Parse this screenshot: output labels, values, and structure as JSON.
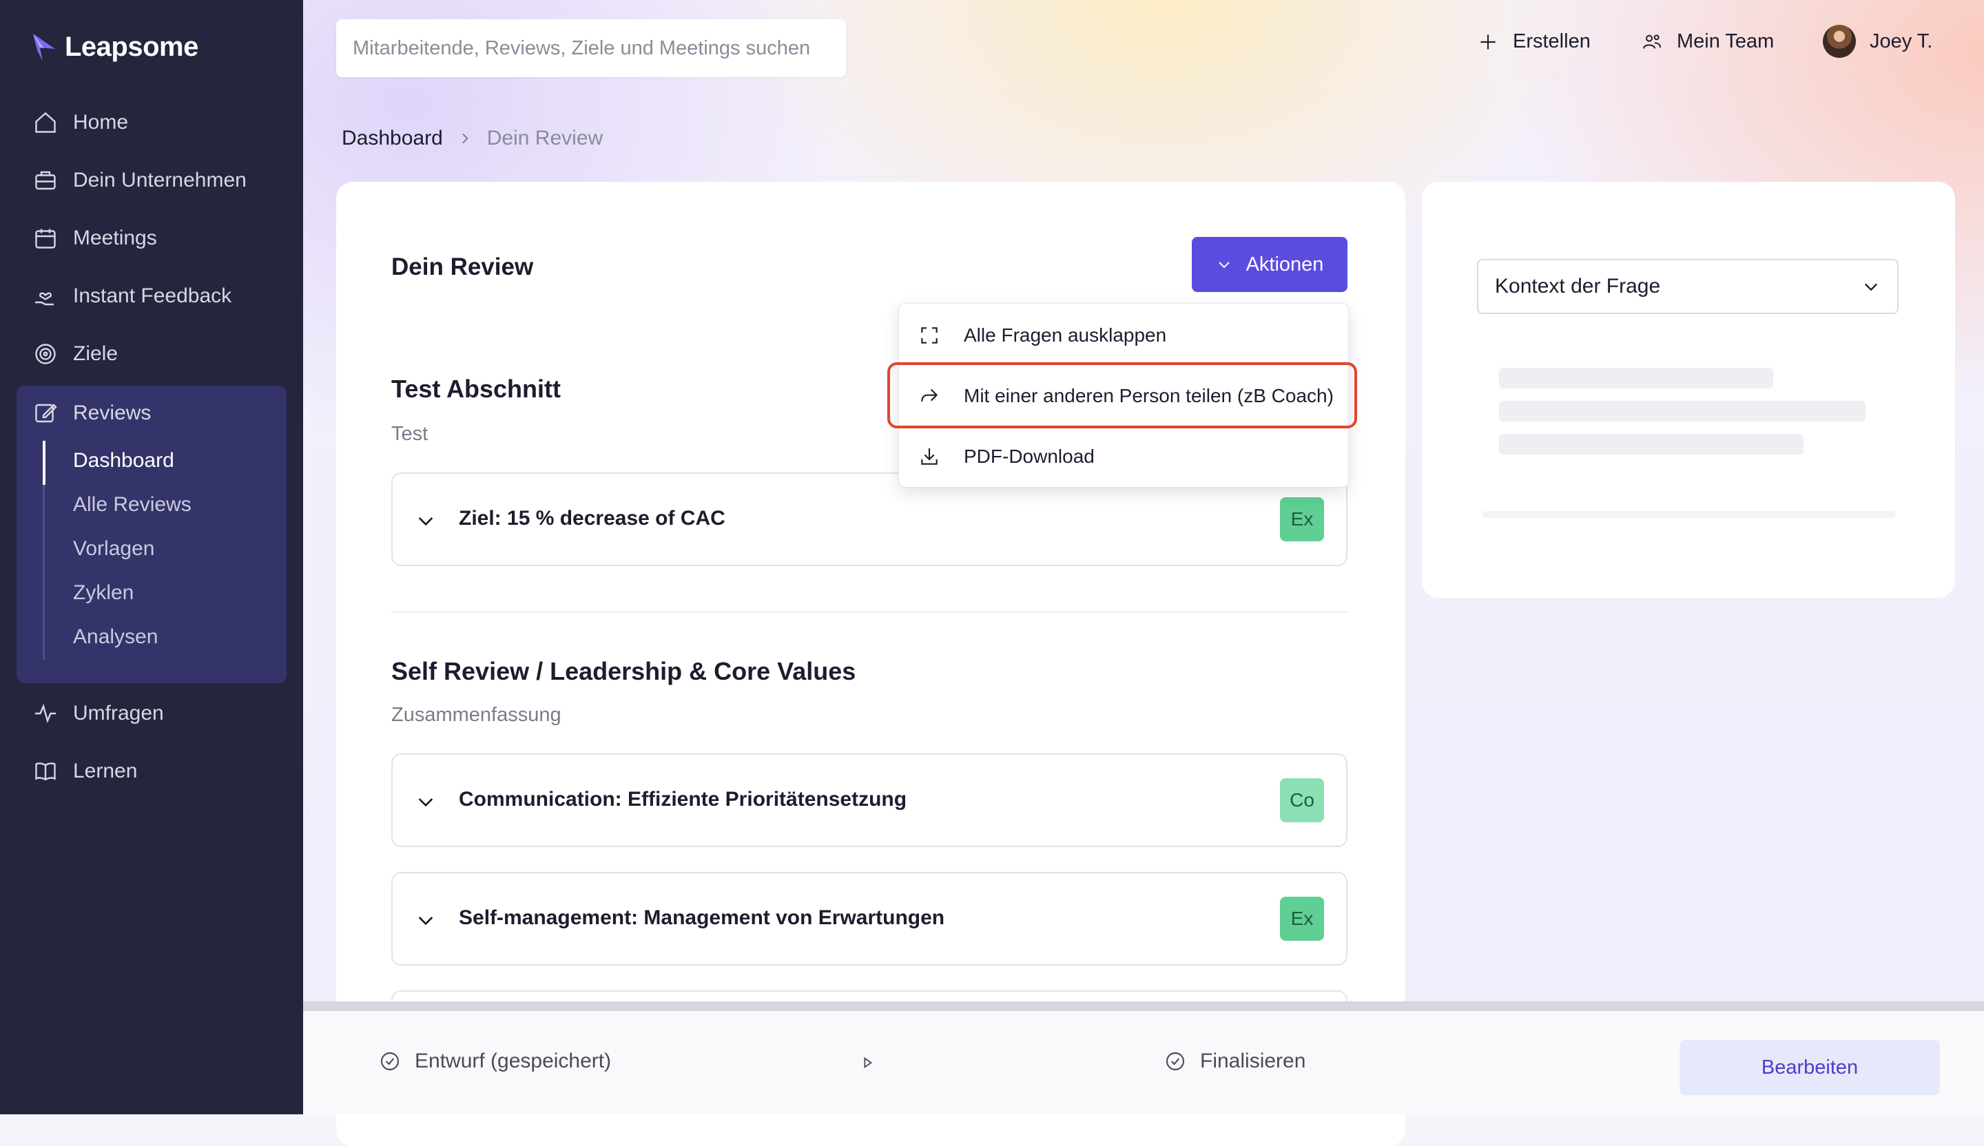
{
  "app": {
    "name": "Leapsome"
  },
  "sidebar": {
    "items": [
      {
        "label": "Home",
        "icon": "home-icon"
      },
      {
        "label": "Dein Unternehmen",
        "icon": "briefcase-icon"
      },
      {
        "label": "Meetings",
        "icon": "calendar-icon"
      },
      {
        "label": "Instant Feedback",
        "icon": "hand-heart-icon"
      },
      {
        "label": "Ziele",
        "icon": "target-icon"
      },
      {
        "label": "Reviews",
        "icon": "edit-icon"
      },
      {
        "label": "Umfragen",
        "icon": "pulse-icon"
      },
      {
        "label": "Lernen",
        "icon": "book-icon"
      }
    ],
    "reviews_sub": [
      "Dashboard",
      "Alle Reviews",
      "Vorlagen",
      "Zyklen",
      "Analysen"
    ],
    "active_sub": "Dashboard"
  },
  "header": {
    "search_placeholder": "Mitarbeitende, Reviews, Ziele und Meetings suchen",
    "create_label": "Erstellen",
    "team_label": "Mein Team",
    "user_name": "Joey T."
  },
  "breadcrumb": {
    "parent": "Dashboard",
    "current": "Dein Review"
  },
  "review": {
    "title": "Dein Review",
    "actions_label": "Aktionen",
    "menu": [
      {
        "label": "Alle Fragen ausklappen",
        "icon": "expand-icon"
      },
      {
        "label": "Mit einer anderen Person teilen (zB Coach)",
        "icon": "share-icon"
      },
      {
        "label": "PDF-Download",
        "icon": "download-icon"
      }
    ],
    "sections": [
      {
        "title": "Test Abschnitt",
        "subtitle": "Test",
        "questions": [
          {
            "title": "Ziel: 15 % decrease of CAC",
            "badge": "Ex"
          }
        ]
      },
      {
        "title": "Self Review / Leadership & Core Values",
        "subtitle": "Zusammenfassung",
        "questions": [
          {
            "title": "Communication: Effiziente Prioritätensetzung",
            "badge": "Co"
          },
          {
            "title": "Self-management: Management von Erwartungen",
            "badge": "Ex"
          }
        ]
      }
    ]
  },
  "context_panel": {
    "select_label": "Kontext der Frage"
  },
  "footer": {
    "step1": "Entwurf (gespeichert)",
    "step2": "Finalisieren",
    "edit_label": "Bearbeiten"
  },
  "colors": {
    "primary": "#5b4ce0",
    "sidebar": "#25253d",
    "highlight": "#e0462c",
    "badge_ex": "#5fcf94",
    "badge_co": "#8be0b3"
  }
}
